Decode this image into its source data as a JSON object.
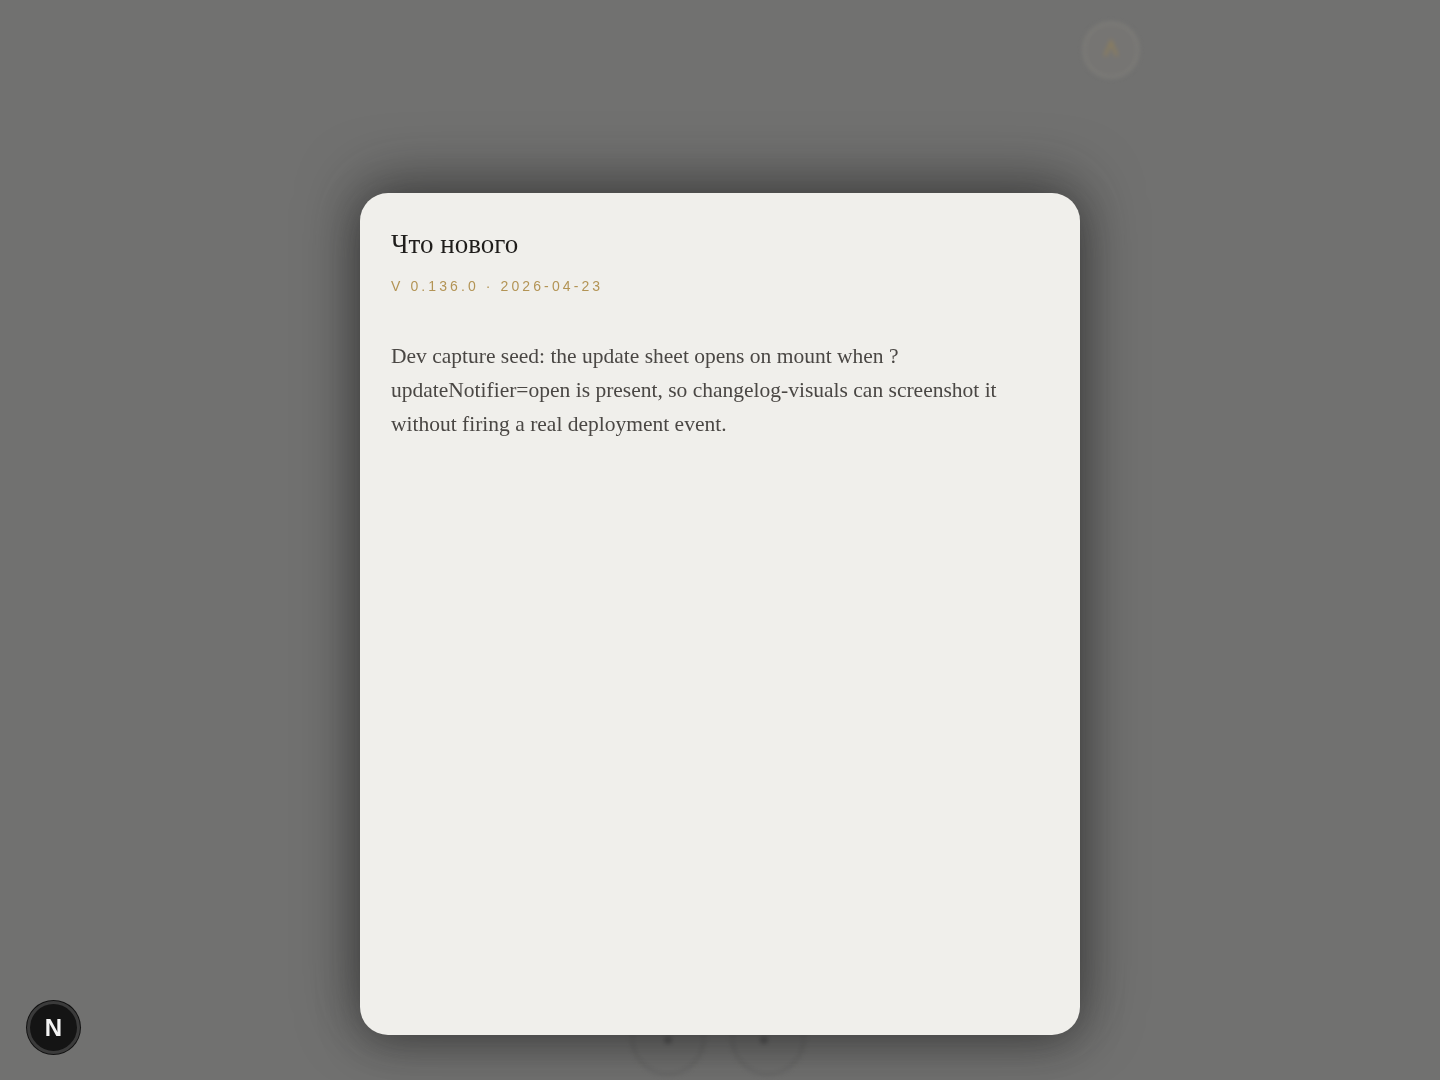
{
  "dialog": {
    "title": "Что нового",
    "version": "V 0.136.0 · 2026-04-23",
    "body": "Dev capture seed: the update sheet opens on mount when ?updateNotifier=open is present, so changelog-visuals can screenshot it without firing a real deployment event."
  },
  "dev_indicator": {
    "label": "N"
  }
}
